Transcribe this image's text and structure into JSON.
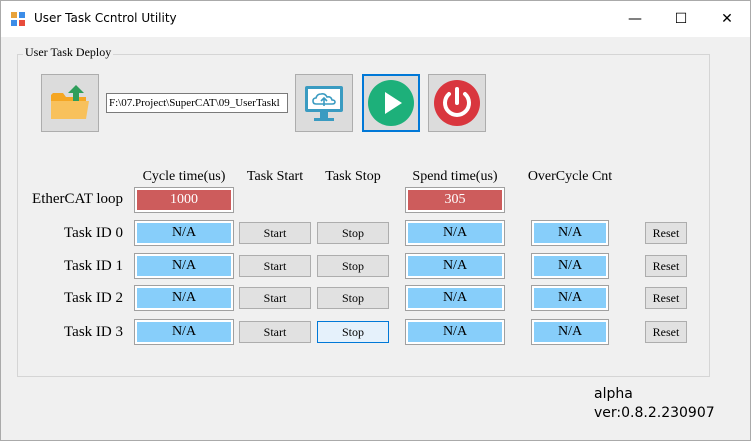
{
  "window": {
    "title": "User Task Ccntrol Utility",
    "minimize": "—",
    "maximize": "☐",
    "close": "✕"
  },
  "group": {
    "label": "User Task Deploy",
    "path_value": "F:\\07.Project\\SuperCAT\\09_UserTaskl"
  },
  "icons": {
    "folder": "folder-upload-icon",
    "deploy": "monitor-cloud-upload-icon",
    "start": "play-icon",
    "stop": "power-icon"
  },
  "columns": {
    "cycle_time": "Cycle time(us)",
    "task_start": "Task Start",
    "task_stop": "Task Stop",
    "spend_time": "Spend time(us)",
    "overcycle": "OverCycle Cnt"
  },
  "ethercat": {
    "label": "EtherCAT loop",
    "cycle_time": "1000",
    "spend_time": "305"
  },
  "tasks": [
    {
      "label": "Task ID 0",
      "cycle_time": "N/A",
      "start": "Start",
      "stop": "Stop",
      "spend_time": "N/A",
      "overcycle": "N/A",
      "reset": "Reset"
    },
    {
      "label": "Task ID 1",
      "cycle_time": "N/A",
      "start": "Start",
      "stop": "Stop",
      "spend_time": "N/A",
      "overcycle": "N/A",
      "reset": "Reset"
    },
    {
      "label": "Task ID 2",
      "cycle_time": "N/A",
      "start": "Start",
      "stop": "Stop",
      "spend_time": "N/A",
      "overcycle": "N/A",
      "reset": "Reset"
    },
    {
      "label": "Task ID 3",
      "cycle_time": "N/A",
      "start": "Start",
      "stop": "Stop",
      "spend_time": "N/A",
      "overcycle": "N/A",
      "reset": "Reset"
    }
  ],
  "footer": {
    "build": "alpha",
    "version": "ver:0.8.2.230907"
  },
  "colors": {
    "red_field": "#cd5c5c",
    "blue_field": "#87cefa",
    "focus_border": "#0078d7",
    "start_green": "#1db07a",
    "stop_red": "#d9363e"
  }
}
